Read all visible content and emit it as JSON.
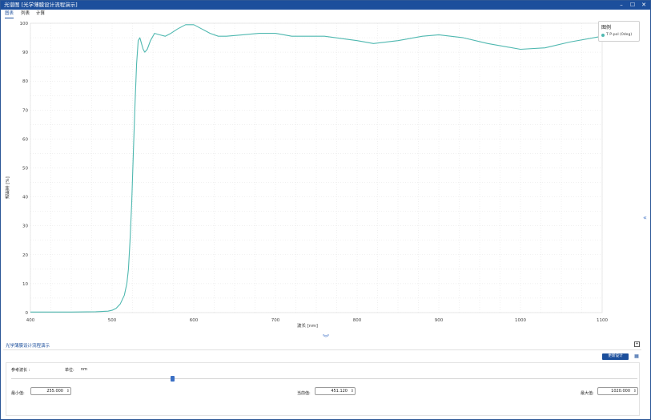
{
  "window": {
    "title": "光谱图 [光学薄膜设计流程演示]",
    "controls": {
      "minimize": "–",
      "maximize": "☐",
      "close": "✕"
    }
  },
  "menu": [
    {
      "label": "图表",
      "active": true
    },
    {
      "label": "列表",
      "active": false
    },
    {
      "label": "计算",
      "active": false
    }
  ],
  "chart_data": {
    "type": "line",
    "xlabel": "波长 [nm]",
    "ylabel": "透射率 [%]",
    "xlim": [
      400,
      1100
    ],
    "ylim": [
      0,
      100
    ],
    "xticks": [
      400,
      500,
      600,
      700,
      800,
      900,
      1000,
      1100
    ],
    "yticks": [
      0,
      10,
      20,
      30,
      40,
      50,
      60,
      70,
      80,
      90,
      100
    ],
    "grid": true,
    "legend_title": "图例",
    "legend_position": "top-right",
    "series": [
      {
        "name": "T P-pol (0deg)",
        "color": "#4fb8b0",
        "x": [
          400,
          450,
          480,
          495,
          500,
          505,
          510,
          515,
          518,
          520,
          522,
          524,
          526,
          528,
          530,
          532,
          534,
          536,
          538,
          540,
          543,
          547,
          552,
          558,
          565,
          572,
          580,
          590,
          600,
          610,
          620,
          630,
          640,
          660,
          680,
          700,
          720,
          760,
          800,
          820,
          850,
          880,
          900,
          930,
          960,
          1000,
          1030,
          1060,
          1100
        ],
        "y": [
          0.2,
          0.2,
          0.3,
          0.5,
          0.8,
          1.5,
          3,
          6,
          10,
          15,
          25,
          38,
          55,
          72,
          86,
          94,
          95,
          93,
          91,
          90,
          91,
          94,
          96.5,
          96,
          95.5,
          96.5,
          98,
          99.5,
          99.5,
          98,
          96.5,
          95.5,
          95.5,
          96,
          96.5,
          96.5,
          95.5,
          95.5,
          94,
          93,
          94,
          95.5,
          96,
          95,
          93,
          91,
          91.5,
          93.5,
          95.5
        ]
      }
    ]
  },
  "panel": {
    "tab_label": "光学薄膜设计流程演示",
    "expand_icon": "+",
    "update_button": "更新设计",
    "reference_label": "参考波长 :",
    "unit_label": "单位:",
    "unit_value": "nm",
    "slider": {
      "min": 255.0,
      "max": 1020.0,
      "value": 451.12
    },
    "min_label": "最小值:",
    "min_value": "255.000",
    "current_label": "当前值:",
    "current_value": "451.120",
    "max_label": "最大值:",
    "max_value": "1020.000"
  },
  "icons": {
    "side_collapse": "«",
    "bottom_collapse": "︾",
    "settings": "▦",
    "spin": "⇕"
  }
}
